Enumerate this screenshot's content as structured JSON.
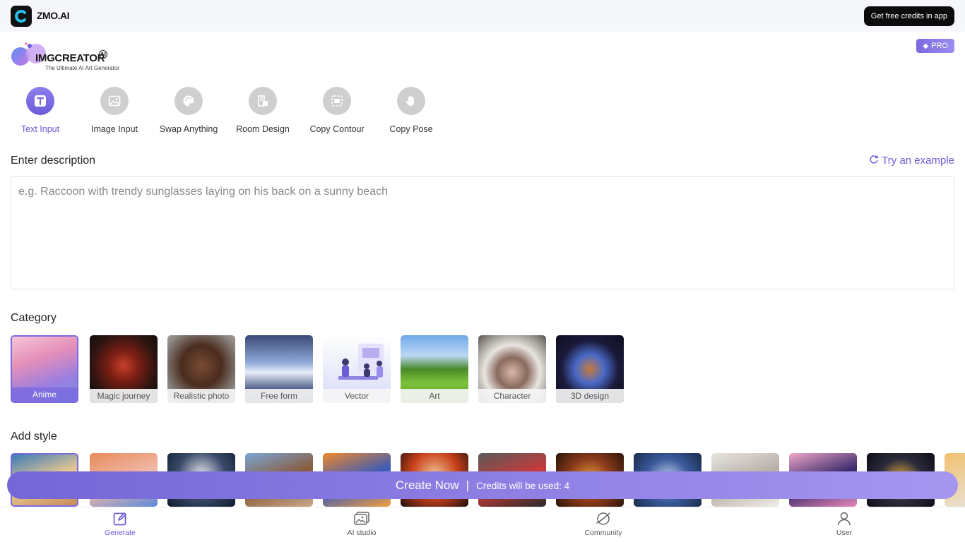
{
  "app": {
    "name": "ZMO.AI",
    "promo_button": "Get free credits in app"
  },
  "brand": {
    "name": "IMGCREATOR",
    "ai_mark": "AI",
    "tagline": "The Ultimate AI Art Generator",
    "pro_label": "PRO"
  },
  "modes": [
    {
      "label": "Text Input",
      "icon": "text-icon",
      "active": true
    },
    {
      "label": "Image Input",
      "icon": "image-icon",
      "active": false
    },
    {
      "label": "Swap Anything",
      "icon": "palette-icon",
      "active": false
    },
    {
      "label": "Room Design",
      "icon": "room-icon",
      "active": false
    },
    {
      "label": "Copy Contour",
      "icon": "contour-icon",
      "active": false
    },
    {
      "label": "Copy Pose",
      "icon": "hand-icon",
      "active": false
    }
  ],
  "description": {
    "title": "Enter description",
    "try_example": "Try an example",
    "placeholder": "e.g. Raccoon with trendy sunglasses laying on his back on a sunny beach"
  },
  "category": {
    "title": "Category",
    "items": [
      {
        "label": "Anime",
        "selected": true
      },
      {
        "label": "Magic journey",
        "selected": false
      },
      {
        "label": "Realistic photo",
        "selected": false
      },
      {
        "label": "Free form",
        "selected": false
      },
      {
        "label": "Vector",
        "selected": false
      },
      {
        "label": "Art",
        "selected": false
      },
      {
        "label": "Character",
        "selected": false
      },
      {
        "label": "3D design",
        "selected": false
      }
    ]
  },
  "style": {
    "title": "Add style",
    "count": 13
  },
  "create": {
    "label": "Create Now",
    "separator": "|",
    "credits_text": "Credits will be used: 4"
  },
  "bottom_nav": [
    {
      "label": "Generate",
      "icon": "edit-icon",
      "active": true
    },
    {
      "label": "AI studio",
      "icon": "gallery-icon",
      "active": false
    },
    {
      "label": "Community",
      "icon": "planet-icon",
      "active": false
    },
    {
      "label": "User",
      "icon": "user-icon",
      "active": false
    }
  ],
  "colors": {
    "accent": "#6b5bd8",
    "accent_light": "#a596f0",
    "topbar_bg": "#f6f7fb",
    "promo_bg": "#0b0b0b"
  }
}
